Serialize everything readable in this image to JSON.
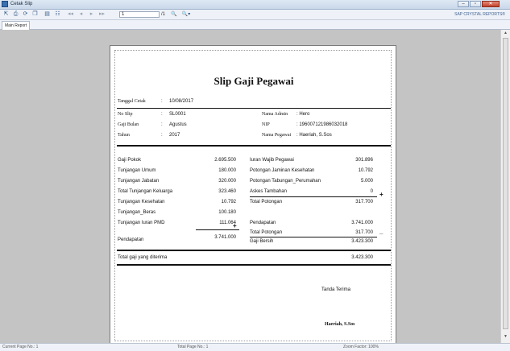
{
  "window": {
    "title": "Cetak Slip",
    "min": "–",
    "max": "▫",
    "close": "✕"
  },
  "toolbar": {
    "icons": [
      "export-icon",
      "print-icon",
      "refresh-icon",
      "copy-icon",
      "group-tree-icon",
      "toggle-panel-icon"
    ],
    "nav": [
      "◂◂",
      "◂",
      "▸",
      "▸▸"
    ],
    "page_value": "1",
    "page_total": "/1",
    "binoculars": "🔍",
    "zoom": "🔍▾",
    "brand": "SAP CRYSTAL REPORTS®"
  },
  "tabs": [
    {
      "label": "Main Report"
    }
  ],
  "status": {
    "left": "Current Page No.: 1",
    "mid": "Total Page No.: 1",
    "right": "Zoom Factor: 100%"
  },
  "report": {
    "title": "Slip Gaji Pegawai",
    "tanggal_label": "Tanggal Cetak",
    "tanggal_value": "10/08/2017",
    "noslip_label": "No Slip",
    "noslip_value": "SL0001",
    "bulan_label": "Gaji Bulan",
    "bulan_value": "Agustus",
    "tahun_label": "Tahun",
    "tahun_value": "2017",
    "admin_label": "Nama Admin",
    "admin_value": ": Hero",
    "nip_label": "NIP",
    "nip_value": ": 196007121986032018",
    "pegawai_label": "Nama Pegawai",
    "pegawai_value": ": Haeriah, S.Sos",
    "colon": ":",
    "income": [
      {
        "label": "Gaji Pokok",
        "value": "2.695.500"
      },
      {
        "label": "Tunjangan Umum",
        "value": "180.000"
      },
      {
        "label": "Tunjangan Jabatan",
        "value": "320.000"
      },
      {
        "label": "Total Tunjangan Keluarga",
        "value": "323.460"
      },
      {
        "label": "Tunjangan Kesehatan",
        "value": "10.792"
      },
      {
        "label": "Tunjangan_Beras",
        "value": "100.180"
      },
      {
        "label": "Tunjangan Iuran PMD",
        "value": "111.064"
      }
    ],
    "pendapatan_label": "Pendapatan",
    "pendapatan_value": "3.741.000",
    "deductions": [
      {
        "label": "Iuran Wajib Pegawai",
        "value": "301.896"
      },
      {
        "label": "Potongan Jaminan Kesehatan",
        "value": "10.792"
      },
      {
        "label": "Potongan Tabungan_Perumahan",
        "value": "5.000"
      },
      {
        "label": "Askes Tambahan",
        "value": "0"
      }
    ],
    "total_potongan_label": "Total Potongan",
    "total_potongan_value": "317.700",
    "summary": [
      {
        "label": "Pendapatan",
        "value": "3.741.000"
      },
      {
        "label": "Total Potongan",
        "value": "317.700"
      },
      {
        "label": "Gaji Bersih",
        "value": "3.423.300"
      }
    ],
    "total_label": "Total gaji yang diterima",
    "total_value": "3.423.300",
    "plus": "+",
    "minus": "_",
    "tanda_terima": "Tanda Terima",
    "signature_name": "Haeriah, S.Sos"
  }
}
